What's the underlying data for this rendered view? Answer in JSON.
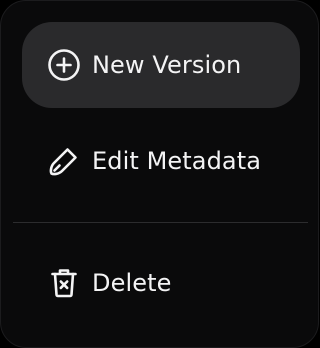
{
  "menu": {
    "items": [
      {
        "label": "New Version",
        "icon": "plus-circle-icon",
        "highlighted": true
      },
      {
        "label": "Edit Metadata",
        "icon": "edit-pencil-icon",
        "highlighted": false
      },
      {
        "label": "Delete",
        "icon": "trash-icon",
        "highlighted": false
      }
    ]
  },
  "colors": {
    "menu_background": "#0a0a0b",
    "highlight_background": "#2a2a2c",
    "text": "#f4f4f5",
    "divider": "#2c2c2e"
  }
}
